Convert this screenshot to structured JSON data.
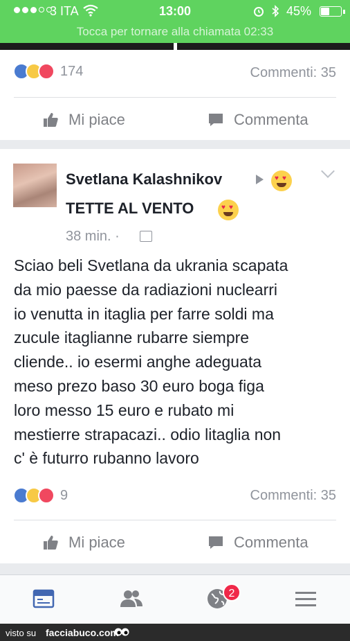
{
  "status_bar": {
    "carrier": "3 ITA",
    "time": "13:00",
    "battery_percent": "45%",
    "battery_level": 0.45,
    "call_banner": "Tocca per tornare alla chiamata 02:33",
    "bar_color": "#5fd35f"
  },
  "previous_post": {
    "reactions": [
      "like-icon",
      "wow-icon",
      "love-icon"
    ],
    "reaction_count": "174",
    "comments": "Commenti: 35",
    "like_label": "Mi piace",
    "comment_label": "Commenta"
  },
  "post": {
    "author": "Svetlana Kalashnikov",
    "feeling": "TETTE AL VENTO",
    "timestamp": "38 min. ·",
    "text_lines": [
      "Sciao beli Svetlana da ukrania scapata",
      "da mio paesse da radiazioni nuclearri",
      "io venutta in itaglia per farre soldi ma",
      "zucule itaglianne rubarre  siempre",
      "cliende.. io esermi anghe adeguata",
      "meso prezo baso 30 euro boga figa",
      "loro messo 15 euro e rubato mi",
      "mestierre strapacazi.. odio litaglia non",
      "c' è futurro rubanno lavoro"
    ],
    "reactions": [
      "like-icon",
      "haha-icon",
      "love-icon"
    ],
    "reaction_count": "9",
    "comments": "Commenti: 35",
    "like_label": "Mi piace",
    "comment_label": "Commenta"
  },
  "tab_bar": {
    "tabs": [
      "news-feed-icon",
      "friends-icon",
      "notifications-globe-icon",
      "menu-icon"
    ],
    "notification_badge": "2",
    "active_color": "#4267b2"
  },
  "watermark": {
    "prefix": "visto su",
    "site": "facciabuco.com"
  }
}
